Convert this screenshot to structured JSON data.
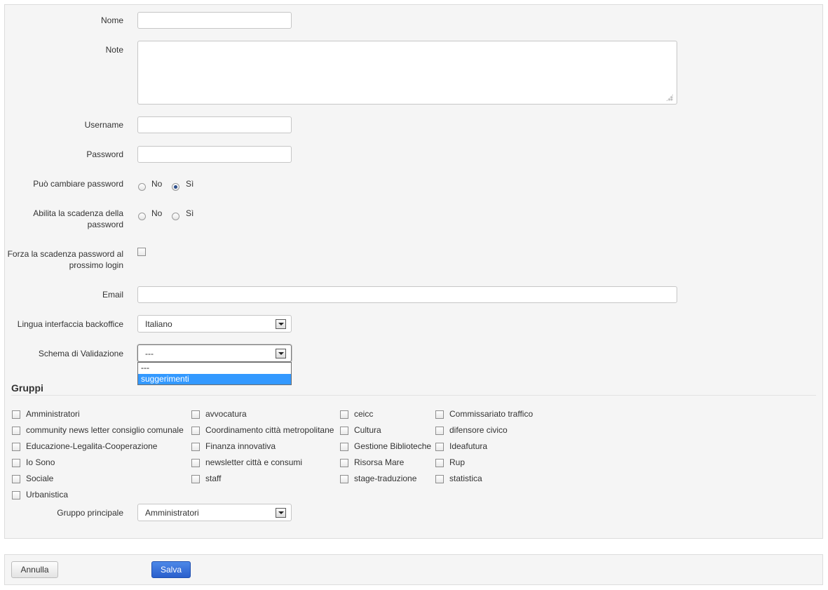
{
  "form": {
    "nome_label": "Nome",
    "note_label": "Note",
    "username_label": "Username",
    "password_label": "Password",
    "cambia_password_label": "Può cambiare password",
    "cambia_password_options": [
      "No",
      "Sì"
    ],
    "cambia_password_selected": "Sì",
    "scadenza_label": "Abilita la scadenza della password",
    "scadenza_options": [
      "No",
      "Sì"
    ],
    "scadenza_selected": null,
    "forza_label": "Forza la scadenza password al prossimo login",
    "email_label": "Email",
    "lingua_label": "Lingua interfaccia backoffice",
    "lingua_value": "Italiano",
    "schema_label": "Schema di Validazione",
    "schema_value": "---",
    "schema_options": [
      "---",
      "suggerimenti"
    ],
    "schema_highlighted": "suggerimenti"
  },
  "gruppi": {
    "title": "Gruppi",
    "columns": [
      [
        "Amministratori",
        "community news letter consiglio comunale",
        "Educazione-Legalita-Cooperazione",
        "Io Sono",
        "Sociale",
        "Urbanistica"
      ],
      [
        "avvocatura",
        "Coordinamento città metropolitane",
        "Finanza innovativa",
        "newsletter città e consumi",
        "staff"
      ],
      [
        "ceicc",
        "Cultura",
        "Gestione Biblioteche",
        "Risorsa Mare",
        "stage-traduzione"
      ],
      [
        "Commissariato traffico",
        "difensore civico",
        "Ideafutura",
        "Rup",
        "statistica"
      ]
    ],
    "principale_label": "Gruppo principale",
    "principale_value": "Amministratori"
  },
  "footer": {
    "cancel_label": "Annulla",
    "save_label": "Salva"
  }
}
